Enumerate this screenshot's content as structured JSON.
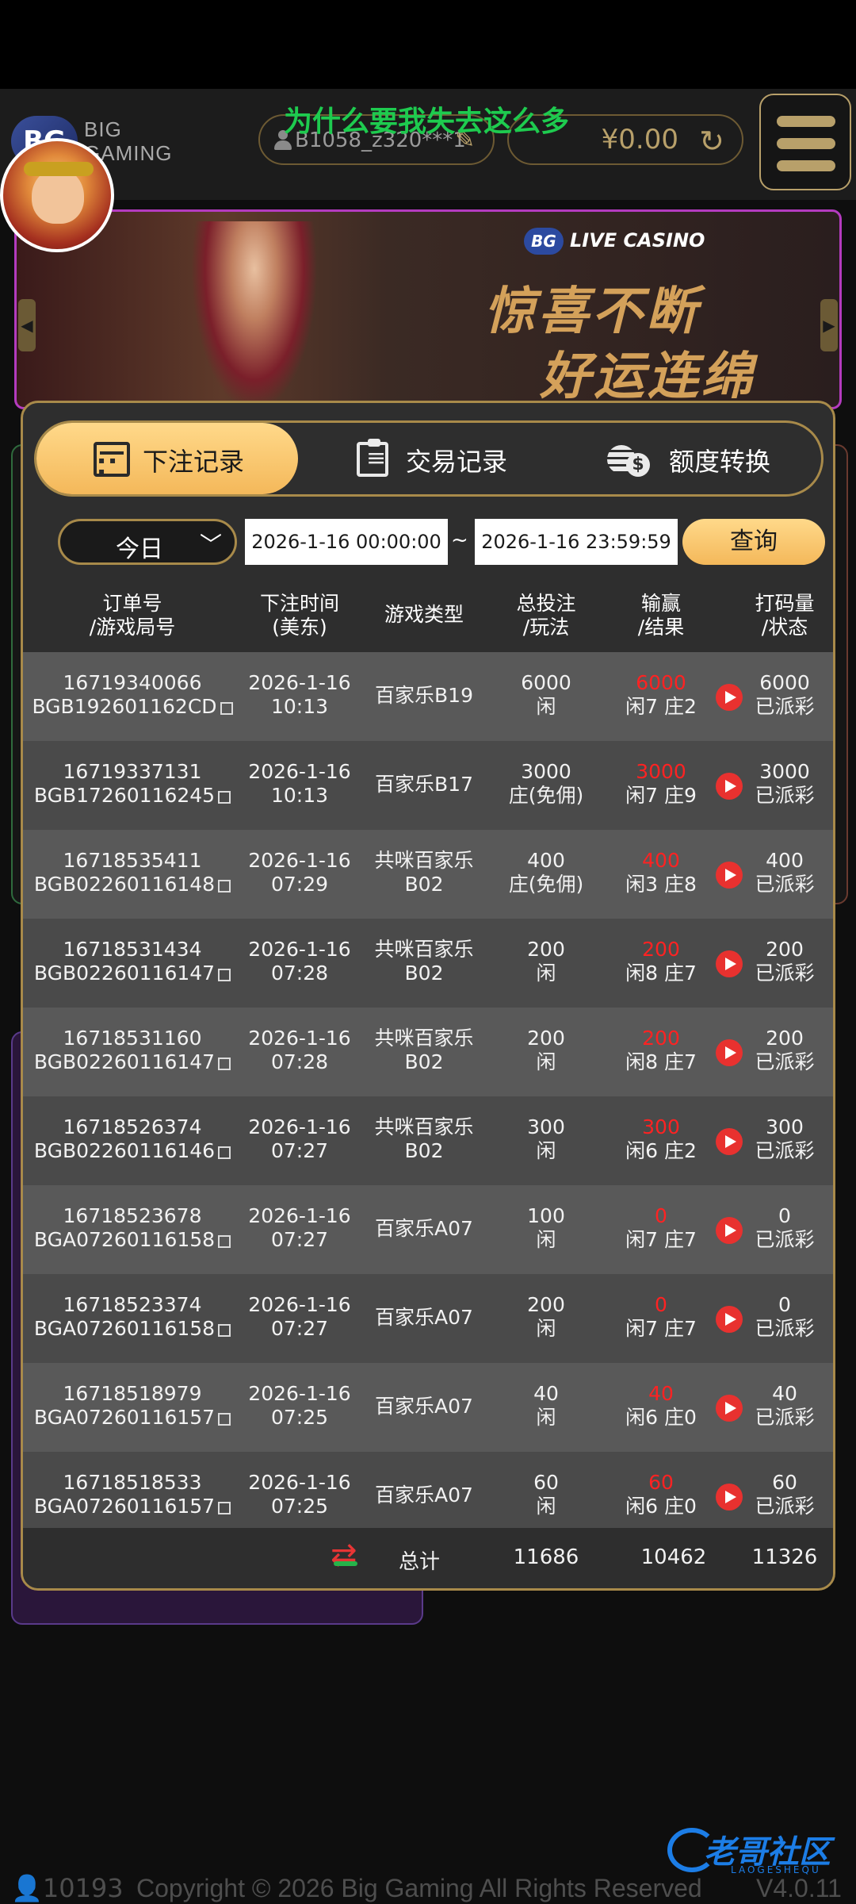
{
  "header": {
    "logo_mark": "BG",
    "logo_line1": "BIG",
    "logo_line2": "GAMING",
    "marquee": "为什么要我失去这么多",
    "username": "B1058_z320***1",
    "balance": "¥0.00"
  },
  "banner": {
    "badge_mark": "BG",
    "badge_text": "LIVE CASINO",
    "title_line1": "惊喜不断",
    "title_line2": "好运连绵"
  },
  "tabs": [
    {
      "label": "下注记录",
      "active": true,
      "icon": "calendar-icon"
    },
    {
      "label": "交易记录",
      "active": false,
      "icon": "clipboard-icon"
    },
    {
      "label": "额度转换",
      "active": false,
      "icon": "coins-icon"
    }
  ],
  "filters": {
    "range": "今日",
    "start": "2026-1-16 00:00:00",
    "separator": "~",
    "end": "2026-1-16 23:59:59",
    "query_label": "查询"
  },
  "table": {
    "headers": [
      "订单号\n/游戏局号",
      "下注时间\n(美东)",
      "游戏类型",
      "总投注\n/玩法",
      "输赢\n/结果",
      "打码量\n/状态"
    ],
    "rows": [
      {
        "order": "16719340066",
        "round": "BGB192601162CD",
        "date": "2026-1-16",
        "time": "10:13",
        "game": "百家乐B19",
        "game2": "",
        "bet": "6000",
        "play": "闲",
        "win": "6000",
        "result": "闲7 庄2",
        "valid": "6000",
        "status": "已派彩"
      },
      {
        "order": "16719337131",
        "round": "BGB17260116245",
        "date": "2026-1-16",
        "time": "10:13",
        "game": "百家乐B17",
        "game2": "",
        "bet": "3000",
        "play": "庄(免佣)",
        "win": "3000",
        "result": "闲7 庄9",
        "valid": "3000",
        "status": "已派彩"
      },
      {
        "order": "16718535411",
        "round": "BGB02260116148",
        "date": "2026-1-16",
        "time": "07:29",
        "game": "共咪百家乐",
        "game2": "B02",
        "bet": "400",
        "play": "庄(免佣)",
        "win": "400",
        "result": "闲3 庄8",
        "valid": "400",
        "status": "已派彩"
      },
      {
        "order": "16718531434",
        "round": "BGB02260116147",
        "date": "2026-1-16",
        "time": "07:28",
        "game": "共咪百家乐",
        "game2": "B02",
        "bet": "200",
        "play": "闲",
        "win": "200",
        "result": "闲8 庄7",
        "valid": "200",
        "status": "已派彩"
      },
      {
        "order": "16718531160",
        "round": "BGB02260116147",
        "date": "2026-1-16",
        "time": "07:28",
        "game": "共咪百家乐",
        "game2": "B02",
        "bet": "200",
        "play": "闲",
        "win": "200",
        "result": "闲8 庄7",
        "valid": "200",
        "status": "已派彩"
      },
      {
        "order": "16718526374",
        "round": "BGB02260116146",
        "date": "2026-1-16",
        "time": "07:27",
        "game": "共咪百家乐",
        "game2": "B02",
        "bet": "300",
        "play": "闲",
        "win": "300",
        "result": "闲6 庄2",
        "valid": "300",
        "status": "已派彩"
      },
      {
        "order": "16718523678",
        "round": "BGA07260116158",
        "date": "2026-1-16",
        "time": "07:27",
        "game": "百家乐A07",
        "game2": "",
        "bet": "100",
        "play": "闲",
        "win": "0",
        "result": "闲7 庄7",
        "valid": "0",
        "status": "已派彩"
      },
      {
        "order": "16718523374",
        "round": "BGA07260116158",
        "date": "2026-1-16",
        "time": "07:27",
        "game": "百家乐A07",
        "game2": "",
        "bet": "200",
        "play": "闲",
        "win": "0",
        "result": "闲7 庄7",
        "valid": "0",
        "status": "已派彩"
      },
      {
        "order": "16718518979",
        "round": "BGA07260116157",
        "date": "2026-1-16",
        "time": "07:25",
        "game": "百家乐A07",
        "game2": "",
        "bet": "40",
        "play": "闲",
        "win": "40",
        "result": "闲6 庄0",
        "valid": "40",
        "status": "已派彩"
      },
      {
        "order": "16718518533",
        "round": "BGA07260116157",
        "date": "2026-1-16",
        "time": "07:25",
        "game": "百家乐A07",
        "game2": "",
        "bet": "60",
        "play": "闲",
        "win": "60",
        "result": "闲6 庄0",
        "valid": "60",
        "status": "已派彩"
      }
    ],
    "totals": {
      "label": "总计",
      "bet": "11686",
      "win": "10462",
      "valid": "11326"
    }
  },
  "footer": {
    "online_count": "10193",
    "copyright": "Copyright © 2026 Big Gaming All Rights Reserved",
    "version": "V4.0.11"
  },
  "watermark": {
    "text": "老哥社区",
    "sub": "LAOGESHEQU"
  },
  "colors": {
    "accent_gold": "#f4b85a",
    "loss_red": "#ff2222",
    "panel_bg": "#2e2e2e",
    "marquee_green": "#1ecb4f"
  }
}
